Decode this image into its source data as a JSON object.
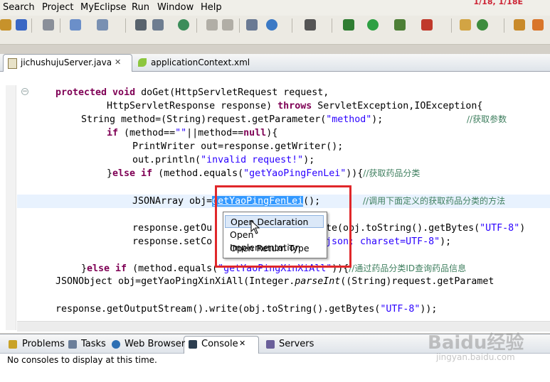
{
  "menu": {
    "items": [
      "Search",
      "Project",
      "MyEclipse",
      "Run",
      "Window",
      "Help"
    ],
    "corner_text": "1/18, 1/18E"
  },
  "tabs": [
    {
      "label": "jichushujuServer.java",
      "icon": "java-file-icon",
      "close": "✕",
      "active": true
    },
    {
      "label": "applicationContext.xml",
      "icon": "spring-xml-icon",
      "active": false
    }
  ],
  "code": {
    "l1_kw": "protected void",
    "l1_rest": " doGet(HttpServletRequest request,",
    "l2_a": "HttpServletResponse response) ",
    "l2_kw": "throws",
    "l2_b": " ServletException,IOException{",
    "l3_a": "String method=(String)request.getParameter(",
    "l3_str": "\"method\"",
    "l3_b": ");",
    "l3_cmt": "//获取参数",
    "l4_kw": "if",
    "l4_a": " (method==",
    "l4_str": "\"\"",
    "l4_b": "||method==",
    "l4_kw2": "null",
    "l4_c": "){",
    "l5": "PrintWriter out=response.getWriter();",
    "l6_a": "out.println(",
    "l6_str": "\"invalid request!\"",
    "l6_b": ");",
    "l7_a": "}",
    "l7_kw": "else if",
    "l7_b": " (method.equals(",
    "l7_str": "\"getYaoPingFenLei\"",
    "l7_c": ")){",
    "l7_cmt": "//获取药品分类",
    "l8_a": "JSONArray obj=",
    "l8_sel": "getYaoPingFenLei",
    "l8_b": "();",
    "l8_cmt": "//调用下面定义的获取药品分类的方法",
    "l9_a": "response.getOu",
    "l9_b": "te(obj.toString().getBytes(",
    "l9_str": "\"UTF-8\"",
    "l9_c": ")",
    "l10_a": "response.setCo",
    "l10_str": "json; charset=UTF-8\"",
    "l10_b": ");",
    "l11_a": "}",
    "l11_kw": "else if",
    "l11_b": " (method.equals(",
    "l11_str": "\"getYaoPingXinXiAll\"",
    "l11_c": ")){",
    "l11_cmt": "//通过药品分类ID查询药品信息",
    "l12_a": "JSONObject obj=getYaoPingXinXiAll(Integer.",
    "l12_ital": "parseInt",
    "l12_b": "((String)request.getParamet",
    "l13_a": "response.getOutputStream().write(obj.toString().getBytes(",
    "l13_str": "\"UTF-8\"",
    "l13_b": "));"
  },
  "context_menu": {
    "items": [
      "Open Declaration",
      "Open Implementation",
      "Open Return Type"
    ],
    "active_index": 0
  },
  "bottom_tabs": [
    {
      "label": "Problems",
      "icon": "problems-icon"
    },
    {
      "label": "Tasks",
      "icon": "tasks-icon"
    },
    {
      "label": "Web Browser",
      "icon": "globe-icon"
    },
    {
      "label": "Console",
      "icon": "console-icon",
      "close": "✕",
      "active": true
    },
    {
      "label": "Servers",
      "icon": "servers-icon"
    }
  ],
  "console_message": "No consoles to display at this time.",
  "watermark": {
    "brand": "Baidu经验",
    "url": "jingyan.baidu.com"
  },
  "colors": {
    "keyword": "#7f0055",
    "string": "#2a00ff",
    "comment": "#3f7f5f",
    "selection": "#3399ff",
    "highlight_box": "#e0272a"
  }
}
